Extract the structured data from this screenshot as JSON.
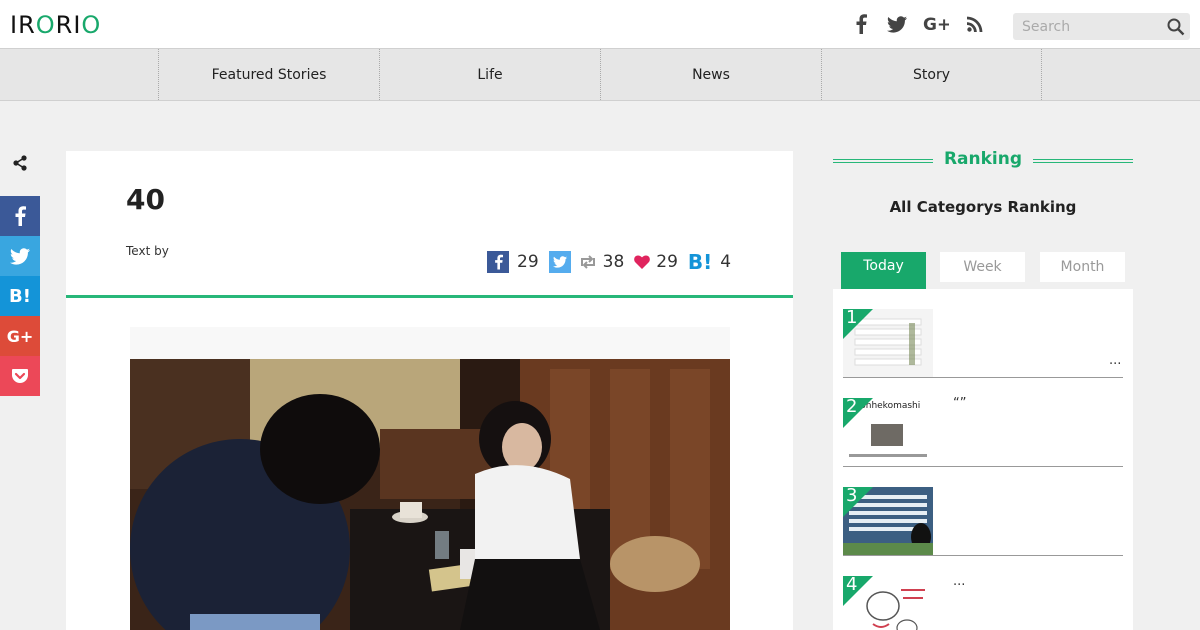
{
  "header": {
    "logo_left": "IR",
    "logo_o1": "O",
    "logo_mid": "RI",
    "logo_o2": "O",
    "social_icons": [
      "facebook-icon",
      "twitter-icon",
      "google-plus-icon",
      "rss-icon"
    ],
    "social_labels": [
      "f",
      "t",
      "G+",
      "rss"
    ],
    "search_placeholder": "Search"
  },
  "nav": {
    "items": [
      "Featured Stories",
      "Life",
      "News",
      "Story"
    ]
  },
  "sharebar": {
    "labels": [
      "f",
      "t",
      "B!",
      "G+",
      "pocket"
    ]
  },
  "article": {
    "title": "40",
    "text_by": "Text by",
    "counts": {
      "facebook": "29",
      "retweet": "38",
      "like": "29",
      "hatena": "4"
    },
    "hatena_label": "B!"
  },
  "sidebar": {
    "ranking_title": "Ranking",
    "ranking_subtitle": "All Categorys Ranking",
    "tabs": [
      "Today",
      "Week",
      "Month"
    ],
    "items": [
      {
        "rank": "1",
        "text": "..."
      },
      {
        "rank": "2",
        "text": "“”",
        "thumb_caption": "utonhekomashi"
      },
      {
        "rank": "3",
        "text": ""
      },
      {
        "rank": "4",
        "text": "..."
      }
    ]
  },
  "colors": {
    "accent": "#18a86b",
    "facebook": "#3b5998",
    "twitter": "#39a6e0",
    "hatena": "#1494d8",
    "google": "#dd4b39",
    "pocket": "#ec4858"
  }
}
